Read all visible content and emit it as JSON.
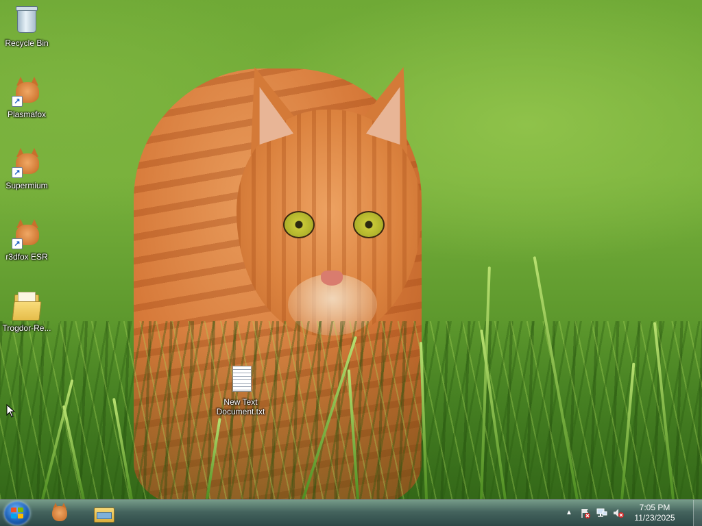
{
  "desktop": {
    "wallpaper": "orange-tabby-cat-in-grass",
    "icons": [
      {
        "label": "Recycle Bin",
        "icon": "recycle-bin-icon"
      },
      {
        "label": "Plasmafox",
        "icon": "cat-browser-icon",
        "shortcut": true
      },
      {
        "label": "Supermium",
        "icon": "cat-browser-icon",
        "shortcut": true
      },
      {
        "label": "r3dfox ESR",
        "icon": "cat-browser-icon",
        "shortcut": true
      },
      {
        "label": "Trogdor-Re...",
        "icon": "folder-icon"
      },
      {
        "label": "New Text Document.txt",
        "icon": "text-file-icon"
      }
    ]
  },
  "taskbar": {
    "pinned": [
      {
        "name": "cat-browser",
        "icon": "cat-browser-icon"
      },
      {
        "name": "file-explorer",
        "icon": "file-explorer-icon"
      }
    ],
    "tray": {
      "icons": [
        "show-hidden-icons-icon",
        "action-center-flag-icon",
        "network-icon",
        "volume-muted-icon"
      ],
      "shortcut_glyph": "↗",
      "expand_glyph": "▲"
    },
    "clock": {
      "time": "7:05 PM",
      "date": "11/23/2025"
    }
  },
  "colors": {
    "taskbar": "#3e5e58",
    "start_orb": "#1a5fb4",
    "icon_text": "#ffffff"
  }
}
